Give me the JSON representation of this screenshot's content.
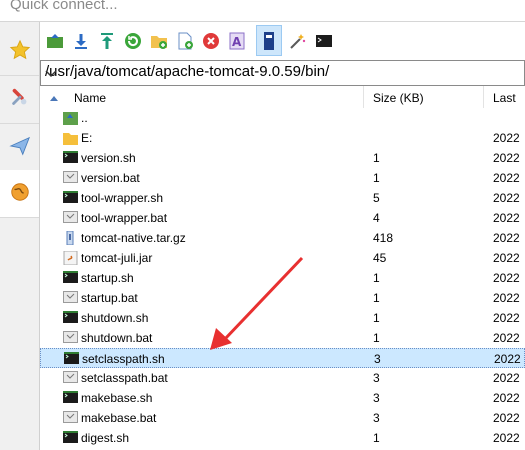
{
  "quick_connect": {
    "placeholder": "Quick connect..."
  },
  "path": {
    "value": "/usr/java/tomcat/apache-tomcat-9.0.59/bin/"
  },
  "columns": {
    "name": "Name",
    "size": "Size (KB)",
    "last": "Last"
  },
  "sidebar": {
    "items": [
      "star-icon",
      "tools-icon",
      "send-icon",
      "globe-icon"
    ]
  },
  "toolbar": {
    "icons": [
      "upload-icon",
      "download-icon",
      "upload-arrow-icon",
      "refresh-icon",
      "new-folder-icon",
      "new-file-icon",
      "delete-icon",
      "rename-icon",
      "properties-icon",
      "magic-wand-icon",
      "terminal-icon"
    ]
  },
  "files": [
    {
      "name": "..",
      "type": "up",
      "size": "",
      "last": ""
    },
    {
      "name": "E:",
      "type": "folder",
      "size": "",
      "last": "2022"
    },
    {
      "name": "version.sh",
      "type": "sh",
      "size": "1",
      "last": "2022"
    },
    {
      "name": "version.bat",
      "type": "bat",
      "size": "1",
      "last": "2022"
    },
    {
      "name": "tool-wrapper.sh",
      "type": "sh",
      "size": "5",
      "last": "2022"
    },
    {
      "name": "tool-wrapper.bat",
      "type": "bat",
      "size": "4",
      "last": "2022"
    },
    {
      "name": "tomcat-native.tar.gz",
      "type": "archive",
      "size": "418",
      "last": "2022"
    },
    {
      "name": "tomcat-juli.jar",
      "type": "jar",
      "size": "45",
      "last": "2022"
    },
    {
      "name": "startup.sh",
      "type": "sh",
      "size": "1",
      "last": "2022"
    },
    {
      "name": "startup.bat",
      "type": "bat",
      "size": "1",
      "last": "2022"
    },
    {
      "name": "shutdown.sh",
      "type": "sh",
      "size": "1",
      "last": "2022"
    },
    {
      "name": "shutdown.bat",
      "type": "bat",
      "size": "1",
      "last": "2022"
    },
    {
      "name": "setclasspath.sh",
      "type": "sh",
      "size": "3",
      "last": "2022",
      "selected": true
    },
    {
      "name": "setclasspath.bat",
      "type": "bat",
      "size": "3",
      "last": "2022"
    },
    {
      "name": "makebase.sh",
      "type": "sh",
      "size": "3",
      "last": "2022"
    },
    {
      "name": "makebase.bat",
      "type": "bat",
      "size": "3",
      "last": "2022"
    },
    {
      "name": "digest.sh",
      "type": "sh",
      "size": "1",
      "last": "2022"
    }
  ]
}
